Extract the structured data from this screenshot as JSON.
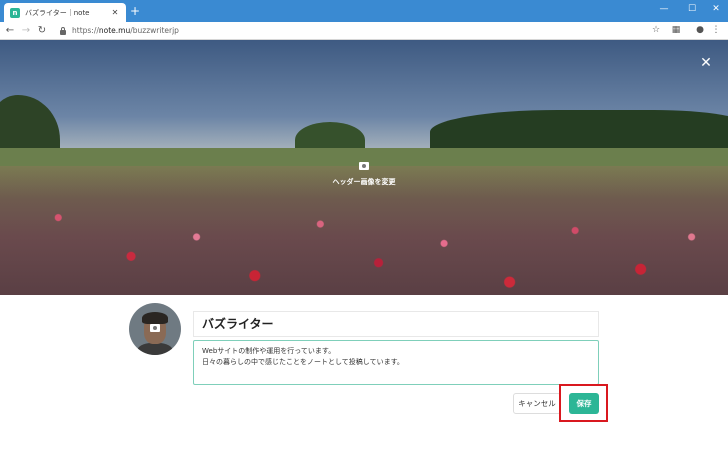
{
  "browser": {
    "tab_title": "バズライター｜note",
    "tab_favicon": "n",
    "new_tab_symbol": "+",
    "url_domain": "note.mu",
    "url_prefix": "https://",
    "url_path": "/buzzwriterjp",
    "window_controls": {
      "minimize": "—",
      "maximize": "☐",
      "close": "✕"
    }
  },
  "header": {
    "change_label": "ヘッダー画像を変更",
    "close_symbol": "✕"
  },
  "profile": {
    "name": "バズライター",
    "bio_lines": [
      "Webサイトの制作や運用を行っています。",
      "日々の暮らしの中で感じたことをノートとして投稿しています。"
    ]
  },
  "actions": {
    "cancel_label": "キャンセル",
    "save_label": "保存"
  },
  "colors": {
    "accent": "#2cb696",
    "highlight": "#d9181f",
    "chrome": "#3a8ad2"
  }
}
